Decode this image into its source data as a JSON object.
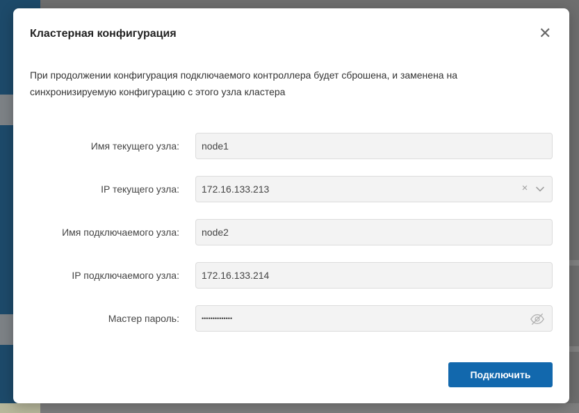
{
  "modal": {
    "title": "Кластерная конфигурация",
    "close_label": "✕",
    "description": "При продолжении конфигурация подключаемого контроллера будет сброшена, и заменена на синхронизируемую конфигурацию с этого узла кластера"
  },
  "form": {
    "current_node_name": {
      "label": "Имя текущего узла:",
      "value": "node1"
    },
    "current_node_ip": {
      "label": "IP текущего узла:",
      "value": "172.16.133.213",
      "options": [
        "172.16.133.213"
      ]
    },
    "connected_node_name": {
      "label": "Имя подключаемого узла:",
      "value": "node2"
    },
    "connected_node_ip": {
      "label": "IP подключаемого узла:",
      "value": "172.16.133.214"
    },
    "master_password": {
      "label": "Мастер пароль:",
      "value": "••••••••••••••"
    }
  },
  "actions": {
    "connect_label": "Подключить"
  },
  "colors": {
    "primary_button": "#1268ad",
    "field_background": "#f3f3f3",
    "sidebar": "#1d4a6a"
  },
  "icons": {
    "close": "close-icon",
    "clear": "clear-icon",
    "dropdown": "chevron-down-icon",
    "password_toggle": "eye-off-icon"
  }
}
